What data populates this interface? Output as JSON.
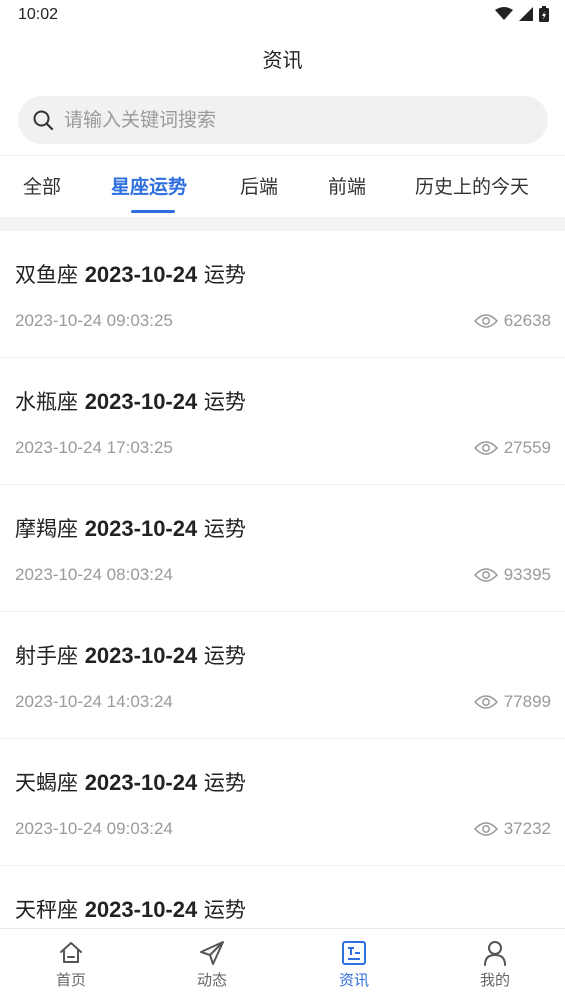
{
  "status": {
    "time": "10:02"
  },
  "header": {
    "title": "资讯"
  },
  "search": {
    "placeholder": "请输入关键词搜索"
  },
  "tabs": [
    {
      "label": "全部"
    },
    {
      "label": "星座运势",
      "active": true
    },
    {
      "label": "后端"
    },
    {
      "label": "前端"
    },
    {
      "label": "历史上的今天"
    }
  ],
  "news": [
    {
      "sign": "双鱼座",
      "date": "2023-10-24",
      "suffix": "运势",
      "time": "2023-10-24 09:03:25",
      "views": "62638"
    },
    {
      "sign": "水瓶座",
      "date": "2023-10-24",
      "suffix": "运势",
      "time": "2023-10-24 17:03:25",
      "views": "27559"
    },
    {
      "sign": "摩羯座",
      "date": "2023-10-24",
      "suffix": "运势",
      "time": "2023-10-24 08:03:24",
      "views": "93395"
    },
    {
      "sign": "射手座",
      "date": "2023-10-24",
      "suffix": "运势",
      "time": "2023-10-24 14:03:24",
      "views": "77899"
    },
    {
      "sign": "天蝎座",
      "date": "2023-10-24",
      "suffix": "运势",
      "time": "2023-10-24 09:03:24",
      "views": "37232"
    },
    {
      "sign": "天秤座",
      "date": "2023-10-24",
      "suffix": "运势",
      "time": "",
      "views": ""
    }
  ],
  "bottom_nav": [
    {
      "label": "首页",
      "icon": "home-icon"
    },
    {
      "label": "动态",
      "icon": "send-icon"
    },
    {
      "label": "资讯",
      "icon": "news-icon",
      "active": true
    },
    {
      "label": "我的",
      "icon": "user-icon"
    }
  ],
  "colors": {
    "accent": "#2f6fe0",
    "muted": "#9a9a9a",
    "text": "#222222"
  }
}
